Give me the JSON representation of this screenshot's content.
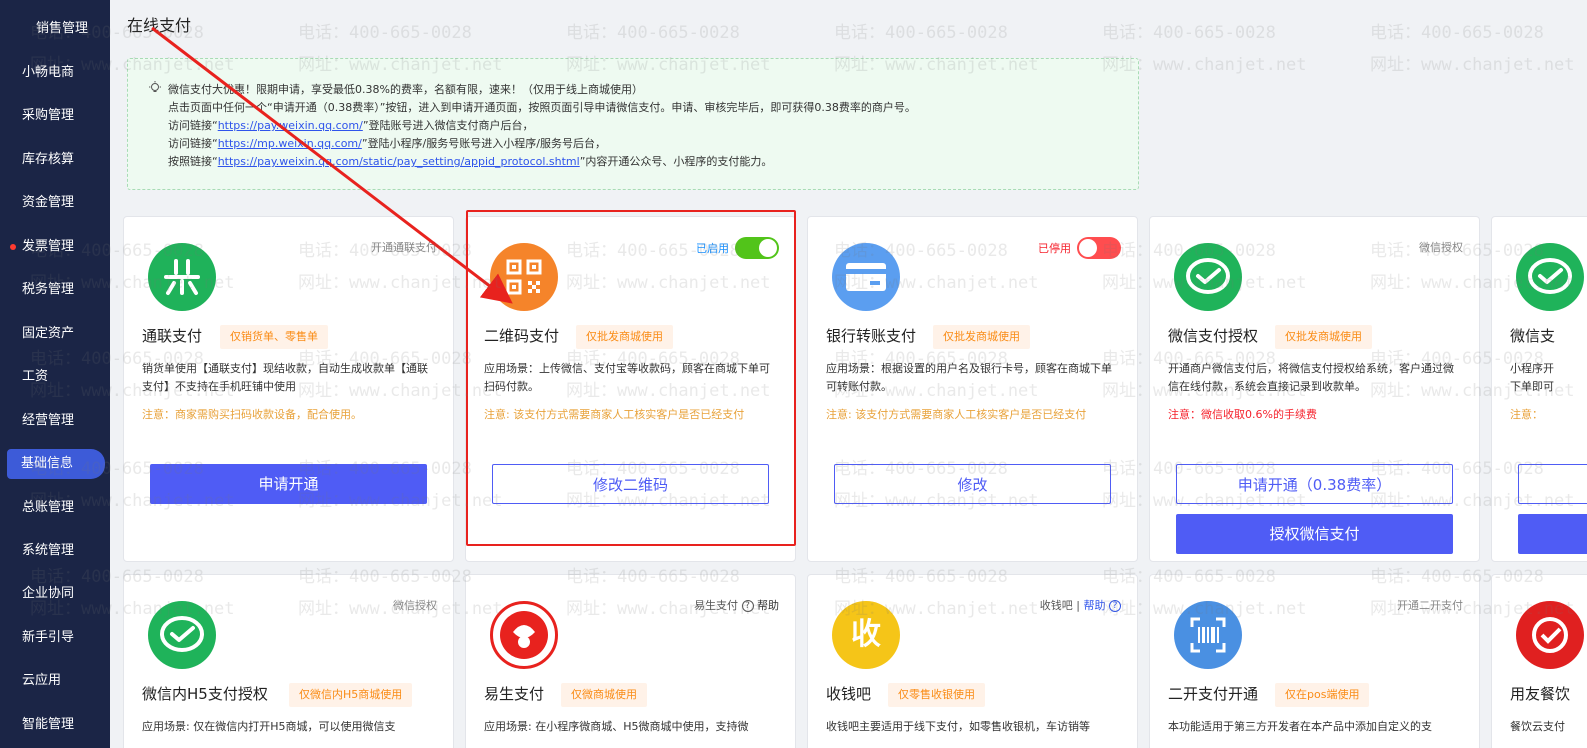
{
  "sidebar": {
    "items": [
      {
        "label": "销售管理"
      },
      {
        "label": "小畅电商"
      },
      {
        "label": "采购管理"
      },
      {
        "label": "库存核算"
      },
      {
        "label": "资金管理"
      },
      {
        "label": "发票管理"
      },
      {
        "label": "税务管理"
      },
      {
        "label": "固定资产"
      },
      {
        "label": "工资"
      },
      {
        "label": "经营管理"
      },
      {
        "label": "基础信息"
      },
      {
        "label": "总账管理"
      },
      {
        "label": "系统管理"
      },
      {
        "label": "企业协同"
      },
      {
        "label": "新手引导"
      },
      {
        "label": "云应用"
      },
      {
        "label": "智能管理"
      }
    ],
    "active": "基础信息",
    "dot_item": "发票管理"
  },
  "page": {
    "title": "在线支付"
  },
  "notice": {
    "line1": "微信支付大优惠！限期申请，享受最低0.38%的费率，名额有限，速来！（仅用于线上商城使用）",
    "line2": "点击页面中任何一个“申请开通（0.38费率）”按钮，进入到申请开通页面，按照页面引导申请微信支付。申请、审核完毕后，即可获得0.38费率的商户号。",
    "line3_pre": "访问链接“",
    "line3_link": "https://pay.weixin.qq.com/",
    "line3_post": "”登陆账号进入微信支付商户后台，",
    "line4_pre": "访问链接“",
    "line4_link": "https://mp.weixin.qq.com/",
    "line4_post": "”登陆小程序/服务号账号进入小程序/服务号后台，",
    "line5_pre": "按照链接“",
    "line5_link": "https://pay.weixin.qq.com/static/pay_setting/appid_protocol.shtml",
    "line5_post": "”内容开通公众号、小程序的支付能力。"
  },
  "cards_row1": [
    {
      "name": "通联支付",
      "tag": "仅销货单、零售单",
      "topright": "开通通联支付",
      "desc": "销货单使用【通联支付】现结收款，自动生成收款单【通联支付】不支持在手机旺铺中使用",
      "note": "注意：商家需购买扫码收款设备，配合使用。",
      "button": "申请开通"
    },
    {
      "name": "二维码支付",
      "tag": "仅批发商城使用",
      "status": "已启用",
      "desc": "应用场景：上传微信、支付宝等收款码，顾客在商城下单可扫码付款。",
      "note": "注意: 该支付方式需要商家人工核实客户是否已经支付",
      "button": "修改二维码"
    },
    {
      "name": "银行转账支付",
      "tag": "仅批发商城使用",
      "status": "已停用",
      "desc": "应用场景：根据设置的用户名及银行卡号，顾客在商城下单可转账付款。",
      "note": "注意: 该支付方式需要商家人工核实客户是否已经支付",
      "button": "修改"
    },
    {
      "name": "微信支付授权",
      "tag": "仅批发商城使用",
      "topright": "微信授权",
      "desc": "开通商户微信支付后，将微信支付授权给系统，客户通过微信在线付款，系统会直接记录到收款单。",
      "note": "注意：微信收取0.6%的手续费",
      "button": "申请开通（0.38费率）",
      "button2": "授权微信支付"
    },
    {
      "name": "微信支",
      "desc": "小程序开\n下单即可",
      "note": "注意："
    }
  ],
  "cards_row2": [
    {
      "name": "微信内H5支付授权",
      "tag": "仅微信内H5商城使用",
      "topright": "微信授权",
      "desc": "应用场景: 仅在微信内打开H5商城，可以使用微信支"
    },
    {
      "name": "易生支付",
      "tag": "仅微商城使用",
      "topright": "易生支付",
      "help": "帮助",
      "desc": "应用场景: 在小程序微商城、H5微商城中使用，支持微"
    },
    {
      "name": "收钱吧",
      "tag": "仅零售收银使用",
      "topright": "收钱吧 |",
      "help": "帮助",
      "desc": "收钱吧主要适用于线下支付，如零售收银机，车访销等"
    },
    {
      "name": "二开支付开通",
      "tag": "仅在pos端使用",
      "topright": "开通二开支付",
      "desc": "本功能适用于第三方开发者在本产品中添加自定义的支"
    },
    {
      "name": "用友餐饮",
      "desc": "餐饮云支付"
    }
  ],
  "icon_texts": {
    "shouqianba": "收"
  },
  "watermark": {
    "phone": "电话：400-665-0028",
    "site": "网址：www.chanjet.net"
  },
  "colors": {
    "sidebar_bg": "#1b2546",
    "accent": "#4f5cf5",
    "tag_text": "#fa8c16",
    "active_green": "#52c41a",
    "stop_red": "#ff4d4f",
    "annotation_red": "#e8221e"
  }
}
